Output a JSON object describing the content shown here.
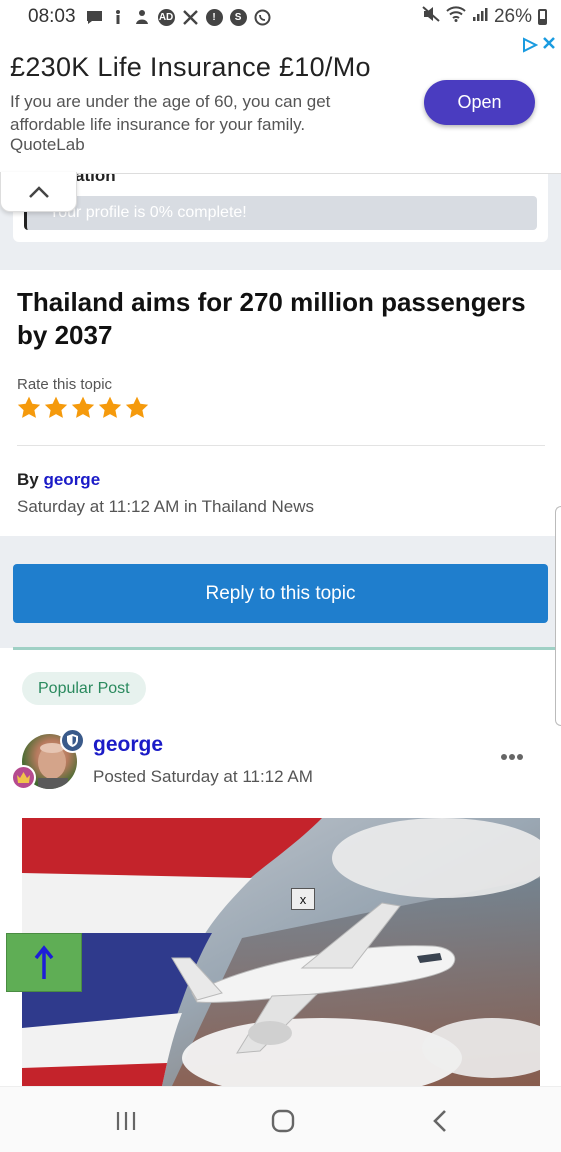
{
  "status_bar": {
    "time": "08:03",
    "battery": "26%",
    "icons": [
      "message-icon",
      "info-icon",
      "figure-icon",
      "ad-icon",
      "x-icon",
      "alert-icon",
      "shazam-icon",
      "whatsapp-icon",
      "mute-icon",
      "wifi-icon",
      "signal-icon",
      "battery-icon"
    ]
  },
  "ad": {
    "title": "£230K Life Insurance £10/Mo",
    "description": "If you are under the age of 60, you can get affordable life insurance for your family.",
    "source": "QuoteLab",
    "open_label": "Open",
    "button_color": "#4a3cc0"
  },
  "profile": {
    "heading_fragment": "ation",
    "progress_label": "Your profile is 0% complete!",
    "progress_percent": 0
  },
  "topic": {
    "title": "Thailand aims for 270 million passengers by 2037",
    "rate_label": "Rate this topic",
    "stars": 5,
    "by_prefix": "By",
    "author": "george",
    "meta": "Saturday at 11:12 AM in Thailand News"
  },
  "reply_button": {
    "label": "Reply to this topic",
    "color": "#1f7ecd"
  },
  "post": {
    "badge": "Popular Post",
    "author": "george",
    "posted": "Posted Saturday at 11:12 AM",
    "close_label": "x"
  },
  "colors": {
    "link": "#1b1bc7",
    "star": "#f59a0c",
    "page_grey": "#ebeef2",
    "scroll_top": "#5fae55"
  }
}
